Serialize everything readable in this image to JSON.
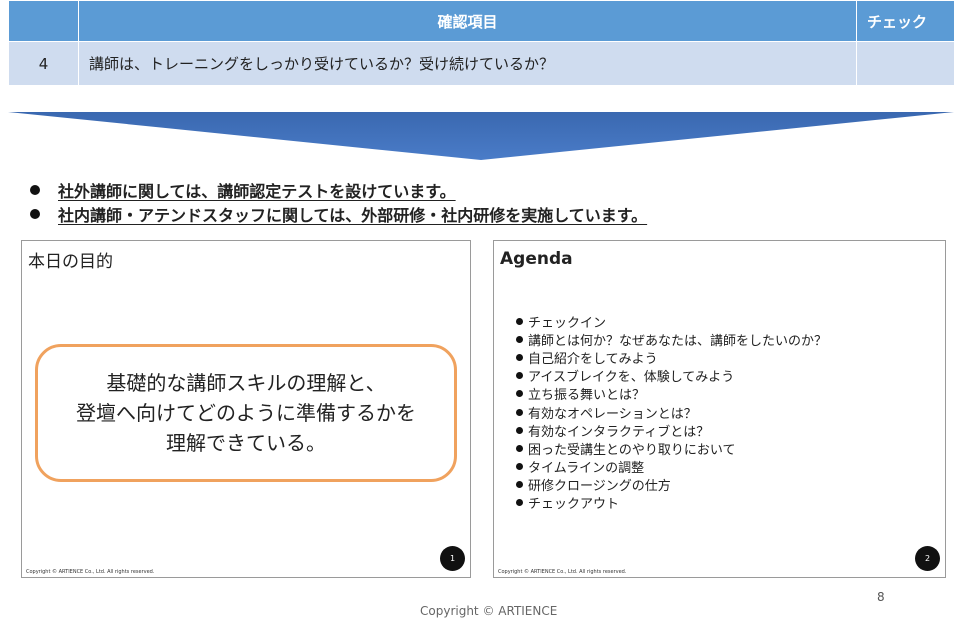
{
  "table": {
    "header": {
      "num": "",
      "item": "確認項目",
      "check": "チェック"
    },
    "row": {
      "num": "4",
      "item": "講師は、トレーニングをしっかり受けているか？受け続けているか？",
      "check": ""
    }
  },
  "bullets": [
    "社外講師に関しては、講師認定テストを設けています。",
    "社内講師・アテンドスタッフに関しては、外部研修・社内研修を実施しています。"
  ],
  "slide1": {
    "title": "本日の目的",
    "lines": [
      "基礎的な講師スキルの理解と、",
      "登壇へ向けてどのように準備するかを",
      "理解できている。"
    ],
    "copyright": "Copyright © ARTIENCE Co., Ltd. All rights reserved.",
    "page": "1"
  },
  "slide2": {
    "title": "Agenda",
    "items": [
      "チェックイン",
      "講師とは何か？なぜあなたは、講師をしたいのか？",
      "自己紹介をしてみよう",
      "アイスブレイクを、体験してみよう",
      "立ち振る舞いとは？",
      "有効なオペレーションとは？",
      "有効なインタラクティブとは？",
      "困った受講生とのやり取りにおいて",
      "タイムラインの調整",
      "研修クロージングの仕方",
      "チェックアウト"
    ],
    "copyright": "Copyright © ARTIENCE Co., Ltd. All rights reserved.",
    "page": "2"
  },
  "footer": {
    "page_number": "8",
    "copyright": "Copyright © ARTIENCE"
  },
  "colors": {
    "header_bg": "#5b9bd5",
    "row_bg": "#cfdcef",
    "arrow": "#3f6db4",
    "box_border": "#f0a25e"
  }
}
